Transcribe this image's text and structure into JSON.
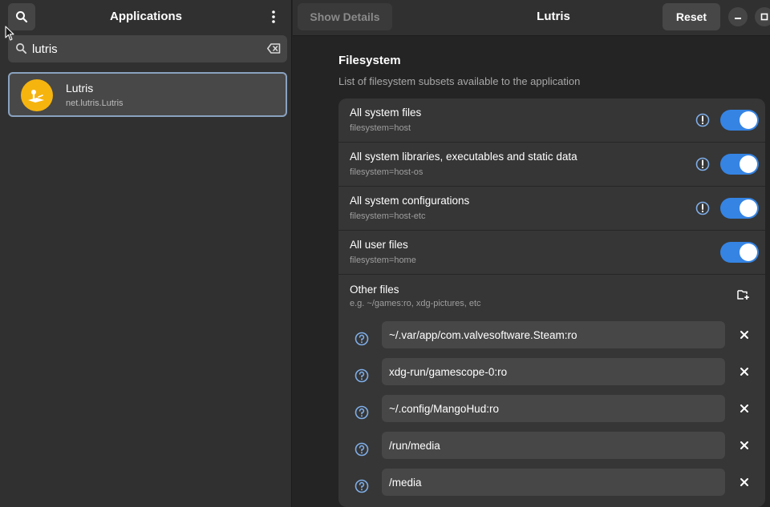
{
  "sidebar": {
    "title": "Applications",
    "search": {
      "value": "lutris"
    },
    "apps": [
      {
        "name": "Lutris",
        "id": "net.lutris.Lutris"
      }
    ]
  },
  "header": {
    "show_details_label": "Show Details",
    "title": "Lutris",
    "reset_label": "Reset"
  },
  "filesystem": {
    "title": "Filesystem",
    "subtitle": "List of filesystem subsets available to the application",
    "rows": [
      {
        "label": "All system files",
        "sub": "filesystem=host",
        "warning": true,
        "enabled": true
      },
      {
        "label": "All system libraries, executables and static data",
        "sub": "filesystem=host-os",
        "warning": true,
        "enabled": true
      },
      {
        "label": "All system configurations",
        "sub": "filesystem=host-etc",
        "warning": true,
        "enabled": true
      },
      {
        "label": "All user files",
        "sub": "filesystem=home",
        "warning": false,
        "enabled": true
      }
    ],
    "other": {
      "label": "Other files",
      "sub": "e.g. ~/games:ro, xdg-pictures, etc",
      "paths": [
        "~/.var/app/com.valvesoftware.Steam:ro",
        "xdg-run/gamescope-0:ro",
        "~/.config/MangoHud:ro",
        "/run/media",
        "/media"
      ]
    }
  },
  "colors": {
    "accent": "#3584e4",
    "help_icon": "#7faee8",
    "app_icon": "#f6b40e"
  },
  "icons": {
    "search": "search-icon",
    "menu": "kebab-menu-icon",
    "clear": "backspace-clear-icon",
    "warning": "warning-icon",
    "help": "help-icon",
    "add_folder": "folder-add-icon",
    "remove": "close-icon"
  }
}
